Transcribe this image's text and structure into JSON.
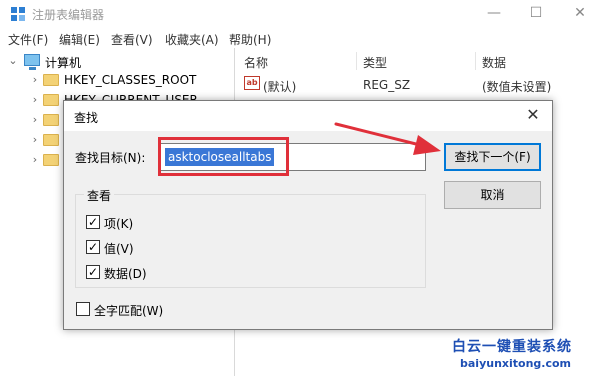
{
  "window": {
    "title": "注册表编辑器",
    "controls": {
      "minimize": "—",
      "maximize": "☐",
      "close": "✕"
    }
  },
  "menu": [
    "文件(F)",
    "编辑(E)",
    "查看(V)",
    "收藏夹(A)",
    "帮助(H)"
  ],
  "tree": {
    "root_label": "计算机",
    "keys": [
      "HKEY_CLASSES_ROOT",
      "HKEY_CURRENT_USER"
    ]
  },
  "list": {
    "headers": {
      "name": "名称",
      "type": "类型",
      "data": "数据"
    },
    "rows": [
      {
        "icon_text": "ab",
        "name": "(默认)",
        "type": "REG_SZ",
        "data": "(数值未设置)"
      }
    ]
  },
  "find_dialog": {
    "title": "查找",
    "close": "✕",
    "target_label": "查找目标(N):",
    "target_value": "asktoclosealltabs",
    "find_next_label": "查找下一个(F)",
    "cancel_label": "取消",
    "group_label": "查看",
    "options": [
      {
        "label": "项(K)",
        "checked": true
      },
      {
        "label": "值(V)",
        "checked": true
      },
      {
        "label": "数据(D)",
        "checked": true
      }
    ],
    "whole_string_label": "全字匹配(W)",
    "whole_string_checked": false
  },
  "watermark": {
    "title": "白云一键重装系统",
    "url": "baiyunxitong.com"
  },
  "colors": {
    "accent": "#0078d7",
    "annotation": "#e0303a",
    "selection": "#3a77d6",
    "watermark": "#1e4fb4"
  }
}
